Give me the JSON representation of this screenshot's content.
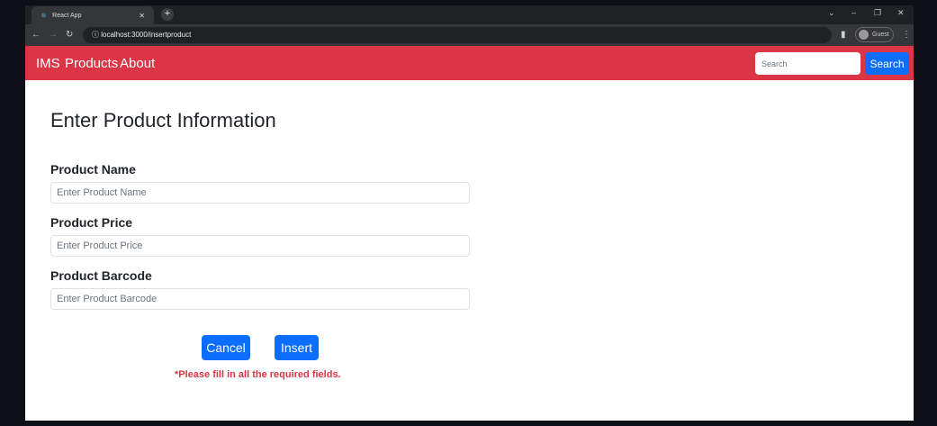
{
  "browser": {
    "tab_title": "React App",
    "url": "localhost:3000/insertproduct",
    "profile": "Guest"
  },
  "navbar": {
    "brand": "IMS",
    "links": [
      "Products",
      "About"
    ],
    "search_placeholder": "Search",
    "search_button": "Search",
    "color": "#dc3545"
  },
  "form": {
    "title": "Enter Product Information",
    "fields": [
      {
        "label": "Product Name",
        "placeholder": "Enter Product Name",
        "value": ""
      },
      {
        "label": "Product Price",
        "placeholder": "Enter Product Price",
        "value": ""
      },
      {
        "label": "Product Barcode",
        "placeholder": "Enter Product Barcode",
        "value": ""
      }
    ],
    "cancel": "Cancel",
    "insert": "Insert",
    "error": "*Please fill in all the required fields.",
    "button_color": "#0d6efd"
  }
}
